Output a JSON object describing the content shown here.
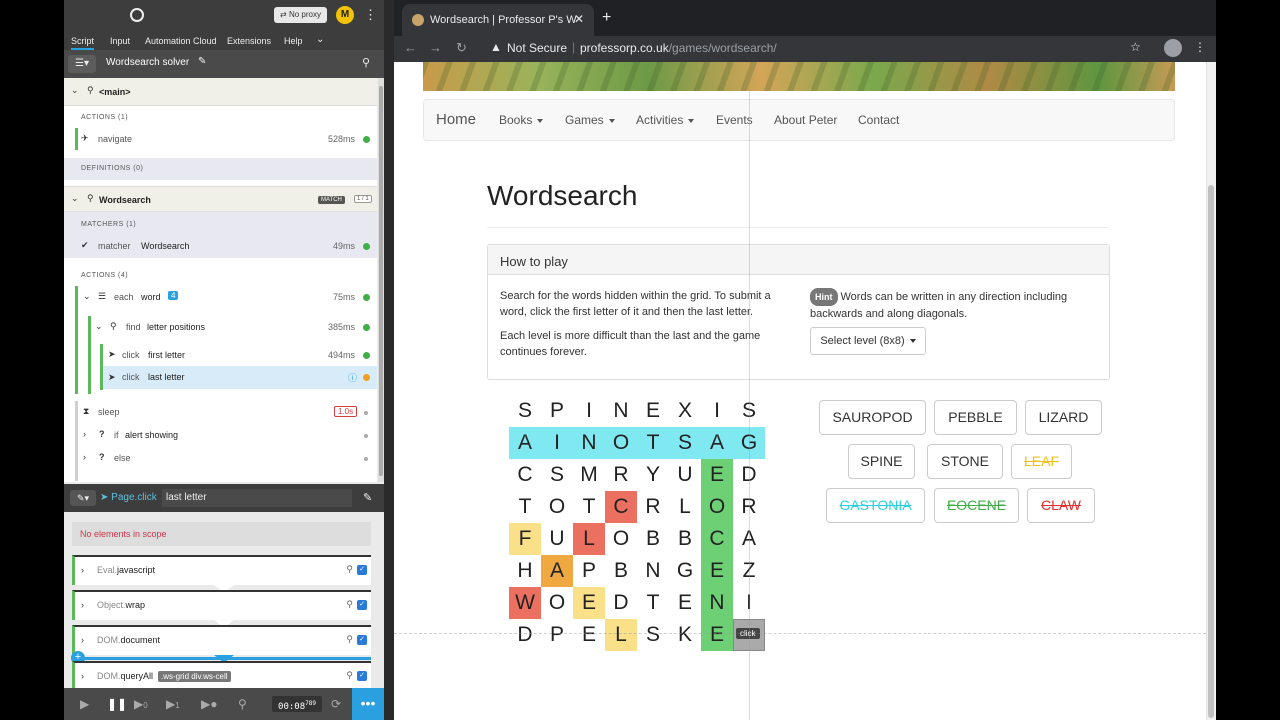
{
  "extension": {
    "tabs": [
      "Script",
      "Input",
      "Automation Cloud",
      "Extensions",
      "Help"
    ],
    "proxy_label": "⇄ No proxy",
    "avatar_letter": "M",
    "script_title": "Wordsearch solver",
    "tree": {
      "main_label": "<main>",
      "actions1_label": "ACTIONS (1)",
      "navigate_label": "navigate",
      "navigate_ms": "528ms",
      "definitions_label": "DEFINITIONS (0)",
      "wordsearch_label": "Wordsearch",
      "match_tag": "MATCH",
      "match_count": "1 / 1",
      "matchers_label": "MATCHERS (1)",
      "matcher_kw": "matcher",
      "matcher_name": "Wordsearch",
      "matcher_ms": "49ms",
      "actions4_label": "ACTIONS (4)",
      "each_kw": "each",
      "each_name": "word",
      "each_count": "4",
      "each_ms": "75ms",
      "find_kw": "find",
      "find_name": "letter positions",
      "find_ms": "385ms",
      "click1_kw": "click",
      "click1_name": "first letter",
      "click1_ms": "494ms",
      "click2_kw": "click",
      "click2_name": "last letter",
      "sleep_label": "sleep",
      "sleep_time": "1.0s",
      "if_kw": "if",
      "if_name": "alert showing",
      "else_label": "else"
    },
    "editor": {
      "command": "Page.click",
      "argument": "last letter",
      "no_elements": "No elements in scope",
      "pipes": [
        {
          "ns": "Eval.",
          "name": "javascript",
          "selector": ""
        },
        {
          "ns": "Object.",
          "name": "wrap",
          "selector": ""
        },
        {
          "ns": "DOM.",
          "name": "document",
          "selector": ""
        },
        {
          "ns": "DOM.",
          "name": "queryAll",
          "selector": ".ws-grid div.ws-cell"
        }
      ]
    },
    "footer": {
      "time": "00:08",
      "time_ms": "789",
      "step_count_a": "0",
      "step_count_b": "1"
    }
  },
  "browser": {
    "tab_title": "Wordsearch | Professor P's Wo",
    "not_secure": "Not Secure",
    "url_host": "professorp.co.uk",
    "url_path": "/games/wordsearch/"
  },
  "page": {
    "nav": {
      "brand": "Home",
      "items": [
        "Books",
        "Games",
        "Activities",
        "Events",
        "About Peter",
        "Contact"
      ]
    },
    "title": "Wordsearch",
    "panel_title": "How to play",
    "instructions_1": "Search for the words hidden within the grid. To submit a word, click the first letter of it and then the last letter.",
    "instructions_2": "Each level is more difficult than the last and the game continues forever.",
    "hint_label": "Hint",
    "hint_text": "Words can be written in any direction including backwards and along diagonals.",
    "level_select": "Select level (8x8)",
    "click_tooltip": "click",
    "grid": [
      [
        "S",
        "P",
        "I",
        "N",
        "E",
        "X",
        "I",
        "S"
      ],
      [
        "A",
        "I",
        "N",
        "O",
        "T",
        "S",
        "A",
        "G"
      ],
      [
        "C",
        "S",
        "M",
        "R",
        "Y",
        "U",
        "E",
        "D"
      ],
      [
        "T",
        "O",
        "T",
        "C",
        "R",
        "L",
        "O",
        "R"
      ],
      [
        "F",
        "U",
        "L",
        "O",
        "B",
        "B",
        "C",
        "A"
      ],
      [
        "H",
        "A",
        "P",
        "B",
        "N",
        "G",
        "E",
        "Z"
      ],
      [
        "W",
        "O",
        "E",
        "D",
        "T",
        "E",
        "N",
        "I"
      ],
      [
        "D",
        "P",
        "E",
        "L",
        "S",
        "K",
        "E",
        ""
      ]
    ],
    "grid_highlights": [
      [
        "",
        "",
        "",
        "",
        "",
        "",
        "",
        ""
      ],
      [
        "cy",
        "cy",
        "cy",
        "cy",
        "cy",
        "cy",
        "cy",
        "cy"
      ],
      [
        "",
        "",
        "",
        "",
        "",
        "",
        "gr",
        ""
      ],
      [
        "",
        "",
        "",
        "rd",
        "",
        "",
        "gr",
        ""
      ],
      [
        "yl",
        "",
        "rd",
        "",
        "",
        "",
        "gr",
        ""
      ],
      [
        "",
        "or",
        "",
        "",
        "",
        "",
        "gr",
        ""
      ],
      [
        "rd",
        "",
        "yl",
        "",
        "",
        "",
        "gr",
        ""
      ],
      [
        "",
        "",
        "",
        "yl",
        "",
        "",
        "gr",
        "gy"
      ]
    ],
    "words": [
      {
        "text": "SAUROPOD",
        "found": false,
        "color": "#333333"
      },
      {
        "text": "PEBBLE",
        "found": false,
        "color": "#333333"
      },
      {
        "text": "LIZARD",
        "found": false,
        "color": "#333333"
      },
      {
        "text": "SPINE",
        "found": false,
        "color": "#333333"
      },
      {
        "text": "STONE",
        "found": false,
        "color": "#333333"
      },
      {
        "text": "LEAF",
        "found": true,
        "color": "#f0c020"
      },
      {
        "text": "GASTONIA",
        "found": true,
        "color": "#2ed0e0"
      },
      {
        "text": "EOCENE",
        "found": true,
        "color": "#3fae49"
      },
      {
        "text": "CLAW",
        "found": true,
        "color": "#e03030"
      }
    ]
  }
}
